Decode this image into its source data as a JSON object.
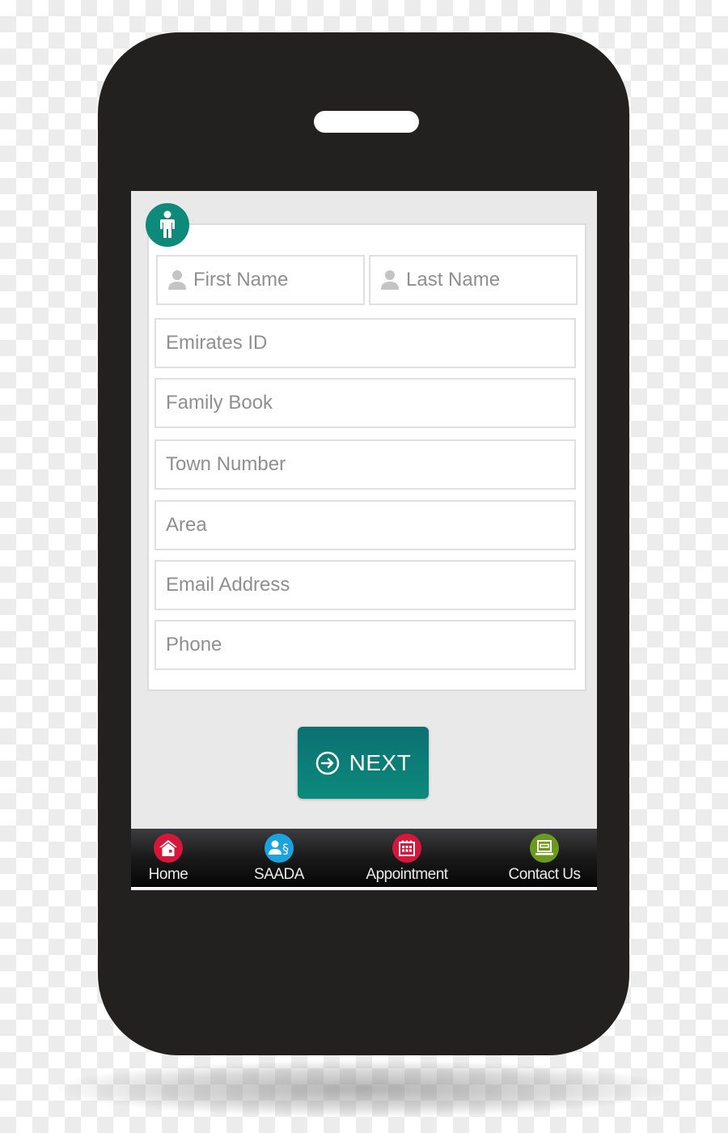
{
  "form": {
    "first_name_placeholder": "First Name",
    "last_name_placeholder": "Last Name",
    "fields": [
      {
        "placeholder": "Emirates ID"
      },
      {
        "placeholder": "Family Book"
      },
      {
        "placeholder": "Town Number"
      },
      {
        "placeholder": "Area"
      },
      {
        "placeholder": "Email Address"
      },
      {
        "placeholder": "Phone"
      }
    ]
  },
  "next_button": {
    "label": "NEXT",
    "icon": "arrow-circle-right-icon"
  },
  "tabbar": {
    "items": [
      {
        "label": "Home",
        "icon": "home-icon",
        "color": "#d6163a"
      },
      {
        "label": "SAADA",
        "icon": "user-section-icon",
        "color": "#1aa3dc"
      },
      {
        "label": "Appointment",
        "icon": "calendar-icon",
        "color": "#d6163a"
      },
      {
        "label": "Contact Us",
        "icon": "computer-icon",
        "color": "#6c9a1f"
      }
    ]
  },
  "colors": {
    "accent": "#0e8a7a",
    "phone_body": "#222120",
    "screen_bg": "#e9e9e9"
  }
}
